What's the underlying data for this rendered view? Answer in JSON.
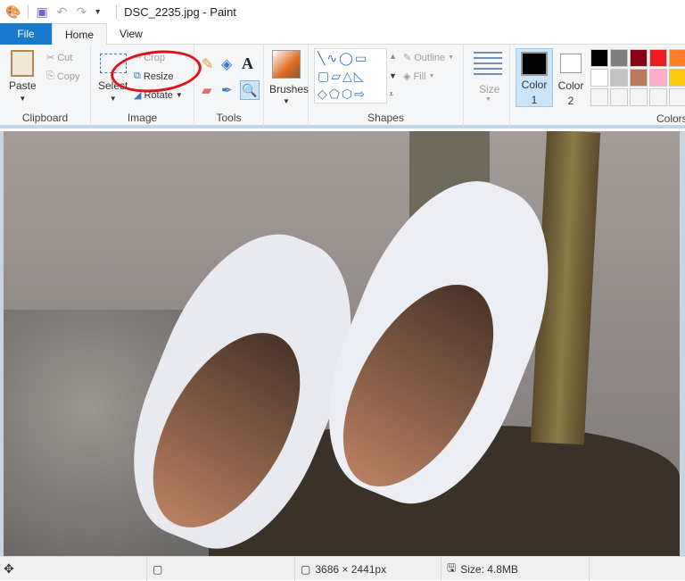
{
  "window": {
    "title": "DSC_2235.jpg - Paint"
  },
  "quick_access": {
    "icons": [
      "paint-app-icon",
      "save-icon",
      "undo-icon",
      "redo-icon",
      "customize-dropdown-icon"
    ]
  },
  "tabs": [
    {
      "label": "File"
    },
    {
      "label": "Home"
    },
    {
      "label": "View"
    }
  ],
  "ribbon": {
    "clipboard": {
      "label": "Clipboard",
      "paste": "Paste",
      "cut": "Cut",
      "copy": "Copy"
    },
    "image": {
      "label": "Image",
      "select": "Select",
      "crop": "Crop",
      "resize": "Resize",
      "rotate": "Rotate"
    },
    "tools": {
      "label": "Tools"
    },
    "brushes": {
      "label": "Brushes"
    },
    "shapes": {
      "label": "Shapes",
      "outline": "Outline",
      "fill": "Fill"
    },
    "size": {
      "label": "Size"
    },
    "color1": {
      "label": "Color",
      "num": "1",
      "color": "#000000"
    },
    "color2": {
      "label": "Color",
      "num": "2",
      "color": "#ffffff"
    },
    "colors": {
      "label": "Colors",
      "swatches": [
        "#000000",
        "#7f7f7f",
        "#880015",
        "#ed1c24",
        "#ff7f27",
        "#ffffff",
        "#c3c3c3",
        "#b97a57",
        "#ffaec9",
        "#ffc90e",
        "#f5f5f5",
        "#f5f5f5",
        "#f5f5f5",
        "#f5f5f5",
        "#f5f5f5"
      ]
    }
  },
  "annotation": {
    "color": "#e0101c",
    "target": "Resize"
  },
  "status": {
    "dimensions": "3686 × 2441px",
    "size": "Size: 4.8MB"
  }
}
